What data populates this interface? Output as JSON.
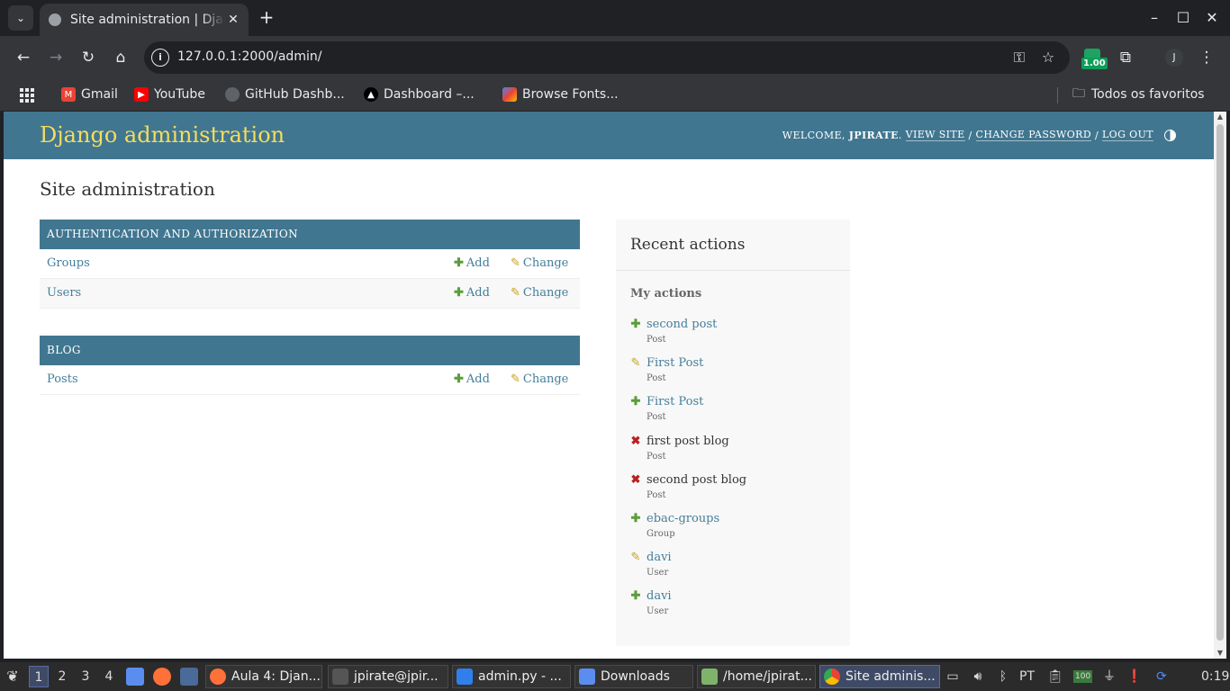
{
  "browser": {
    "tab_title": "Site administration | Django site admin",
    "url": "127.0.0.1:2000/admin/",
    "extension_badge": "1.00",
    "profile_initial": "J",
    "bookmarks": [
      {
        "label": "Gmail",
        "icon": "gmail-icon",
        "color": "#ea4335"
      },
      {
        "label": "YouTube",
        "icon": "youtube-icon",
        "color": "#ff0000"
      },
      {
        "label": "GitHub Dashb...",
        "icon": "github-icon",
        "color": "#5f6368"
      },
      {
        "label": "Dashboard –...",
        "icon": "vercel-icon",
        "color": "#000000"
      },
      {
        "label": "Browse Fonts...",
        "icon": "google-fonts-icon",
        "color": "#4285f4"
      }
    ],
    "all_bookmarks_label": "Todos os favoritos"
  },
  "django": {
    "site_header": "Django administration",
    "user_tools": {
      "welcome": "WELCOME,",
      "username": "JPIRATE",
      "view_site": "VIEW SITE",
      "change_password": "CHANGE PASSWORD",
      "log_out": "LOG OUT"
    },
    "page_title": "Site administration",
    "apps": [
      {
        "name": "AUTHENTICATION AND AUTHORIZATION",
        "models": [
          {
            "name": "Groups",
            "add": "Add",
            "change": "Change"
          },
          {
            "name": "Users",
            "add": "Add",
            "change": "Change"
          }
        ]
      },
      {
        "name": "BLOG",
        "models": [
          {
            "name": "Posts",
            "add": "Add",
            "change": "Change"
          }
        ]
      }
    ],
    "recent_actions": {
      "title": "Recent actions",
      "subtitle": "My actions",
      "items": [
        {
          "kind": "add",
          "name": "second post",
          "type": "Post"
        },
        {
          "kind": "edit",
          "name": "First Post",
          "type": "Post"
        },
        {
          "kind": "add",
          "name": "First Post",
          "type": "Post"
        },
        {
          "kind": "delete",
          "name": "first post blog",
          "type": "Post"
        },
        {
          "kind": "delete",
          "name": "second post blog",
          "type": "Post"
        },
        {
          "kind": "add",
          "name": "ebac-groups",
          "type": "Group"
        },
        {
          "kind": "edit",
          "name": "davi",
          "type": "User"
        },
        {
          "kind": "add",
          "name": "davi",
          "type": "User"
        }
      ]
    }
  },
  "taskbar": {
    "workspaces": [
      "1",
      "2",
      "3",
      "4"
    ],
    "active_workspace": "1",
    "tasks": [
      {
        "label": "Aula 4: Djan...",
        "icon": "firefox-icon",
        "color": "#ff7139"
      },
      {
        "label": "jpirate@jpir...",
        "icon": "terminal-icon",
        "color": "#555555"
      },
      {
        "label": "admin.py - ...",
        "icon": "vscode-icon",
        "color": "#2f80ed"
      },
      {
        "label": "Downloads",
        "icon": "folder-icon",
        "color": "#5b8def"
      },
      {
        "label": "/home/jpirat...",
        "icon": "image-viewer-icon",
        "color": "#7fb36b"
      },
      {
        "label": "Site adminis...",
        "icon": "chrome-icon",
        "color": "#4285f4"
      }
    ],
    "keyboard_layout": "PT",
    "battery": "100",
    "clock": "0:19"
  }
}
